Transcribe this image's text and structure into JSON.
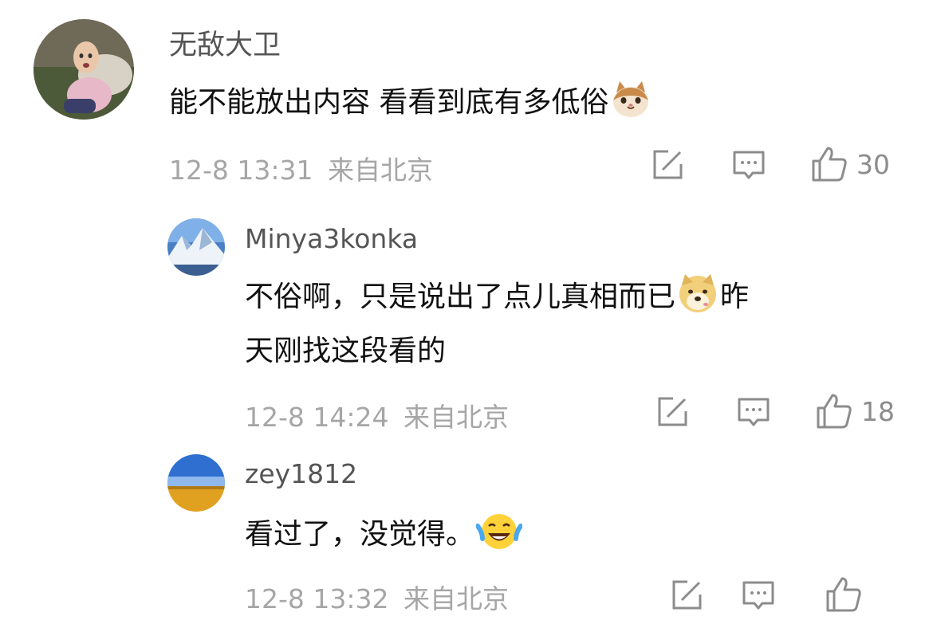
{
  "comments": [
    {
      "name": "无敌大卫",
      "text": "能不能放出内容 看看到底有多低俗",
      "emoji": "cat-face-emoji",
      "time": "12-8 13:31",
      "location": "来自北京",
      "likes": "30"
    },
    {
      "name": "Minya3konka",
      "text_line1": "不俗啊，只是说出了点儿真相而已",
      "emoji": "doge-emoji",
      "text_line1_after": "昨",
      "text_line2": "天刚找这段看的",
      "time": "12-8 14:24",
      "location": "来自北京",
      "likes": "18"
    },
    {
      "name": "zey1812",
      "text": "看过了，没觉得。",
      "emoji": "laughing-tears-emoji",
      "time": "12-8 13:32",
      "location": "来自北京"
    }
  ],
  "icons": {
    "share": "share-edit-icon",
    "reply": "comment-icon",
    "like": "thumbs-up-icon"
  },
  "colors": {
    "meta": "#a6a6a6",
    "icon": "#8c8c8c",
    "name": "#555555",
    "text": "#111111"
  }
}
